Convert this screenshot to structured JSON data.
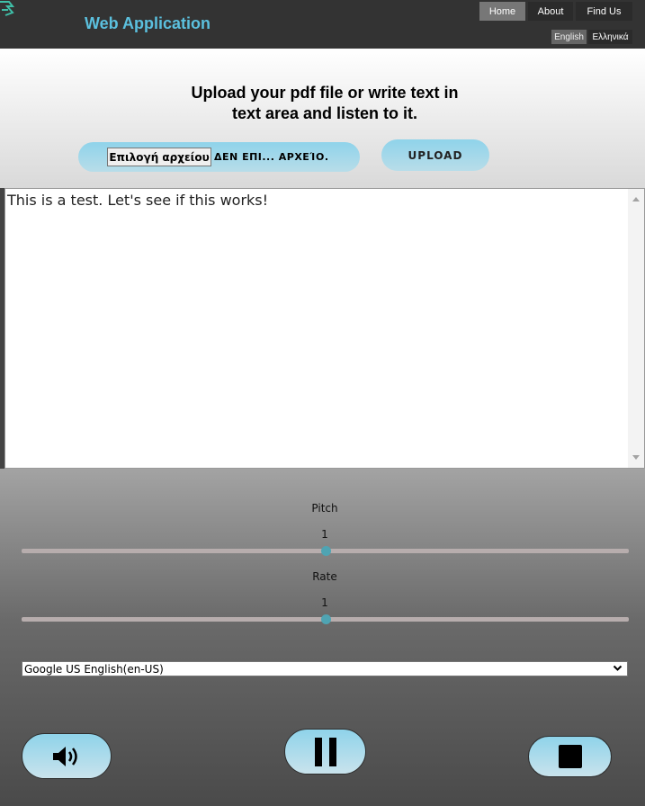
{
  "header": {
    "app_title": "Web Application",
    "nav": [
      {
        "label": "Home",
        "active": true
      },
      {
        "label": "About",
        "active": false
      },
      {
        "label": "Find Us",
        "active": false
      }
    ],
    "languages": [
      {
        "label": "English",
        "active": true
      },
      {
        "label": "Ελληνικά",
        "active": false
      }
    ]
  },
  "upload": {
    "heading_line1": "Upload your pdf file or write text in",
    "heading_line2": "text area and listen to it.",
    "file_button_label": "Επιλογή αρχείου",
    "file_status": "ΔΕΝ ΕΠΙ... ΑΡΧΕΊΟ.",
    "upload_button_label": "UPLOAD"
  },
  "text_area": {
    "value": "This is a test. Let's see if this works!"
  },
  "controls": {
    "pitch": {
      "label": "Pitch",
      "value": "1",
      "level": 0.5
    },
    "rate": {
      "label": "Rate",
      "value": "1",
      "level": 0.5
    },
    "voice": {
      "selected": "Google US English(en-US)"
    },
    "buttons": {
      "speak_icon": "speaker-icon",
      "pause_icon": "pause-icon",
      "stop_icon": "stop-icon"
    }
  },
  "colors": {
    "accent": "#5bc0de",
    "header_bg": "#333333",
    "slider_thumb": "#4fa4b3"
  }
}
